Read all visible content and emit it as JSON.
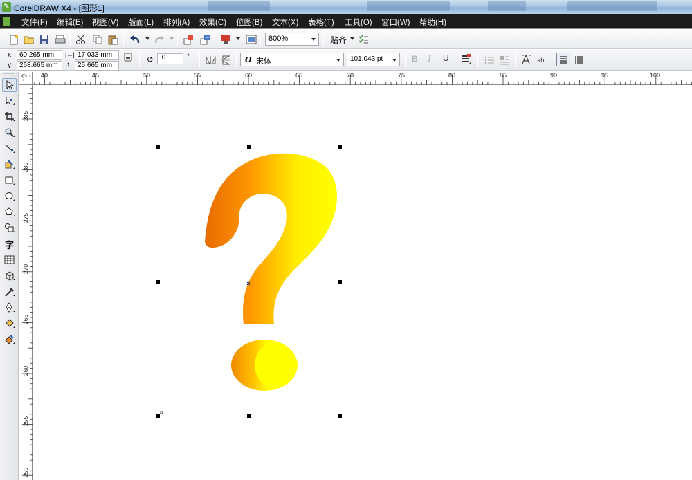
{
  "window": {
    "title": "CorelDRAW X4 - [图形1]",
    "app_icon": "coreldraw-icon"
  },
  "menu": {
    "items": [
      "文件(F)",
      "编辑(E)",
      "视图(V)",
      "版面(L)",
      "排列(A)",
      "效果(C)",
      "位图(B)",
      "文本(X)",
      "表格(T)",
      "工具(O)",
      "窗口(W)",
      "帮助(H)"
    ]
  },
  "toolbar": {
    "zoom": "800%",
    "snap_label": "贴齐"
  },
  "properties": {
    "x_label": "x:",
    "y_label": "y:",
    "x_value": "60.265 mm",
    "y_value": "268.665 mm",
    "width_value": "17.033 mm",
    "height_value": "25.665 mm",
    "rotation_value": ".0",
    "degree_symbol": "°",
    "font_icon": "O",
    "font_name": "宋体",
    "font_size": "101.043 pt"
  },
  "rulers": {
    "top_labels": [
      "40",
      "45",
      "50",
      "55",
      "60",
      "65",
      "70",
      "75",
      "80",
      "85",
      "90",
      "95",
      "100"
    ],
    "left_labels": [
      "285",
      "280",
      "275",
      "270",
      "265",
      "260",
      "255",
      "250"
    ]
  },
  "canvas": {
    "selected_object": "question-mark-3d",
    "gradient_colors": [
      "#ffff00",
      "#ff9900",
      "#e86a00"
    ]
  }
}
